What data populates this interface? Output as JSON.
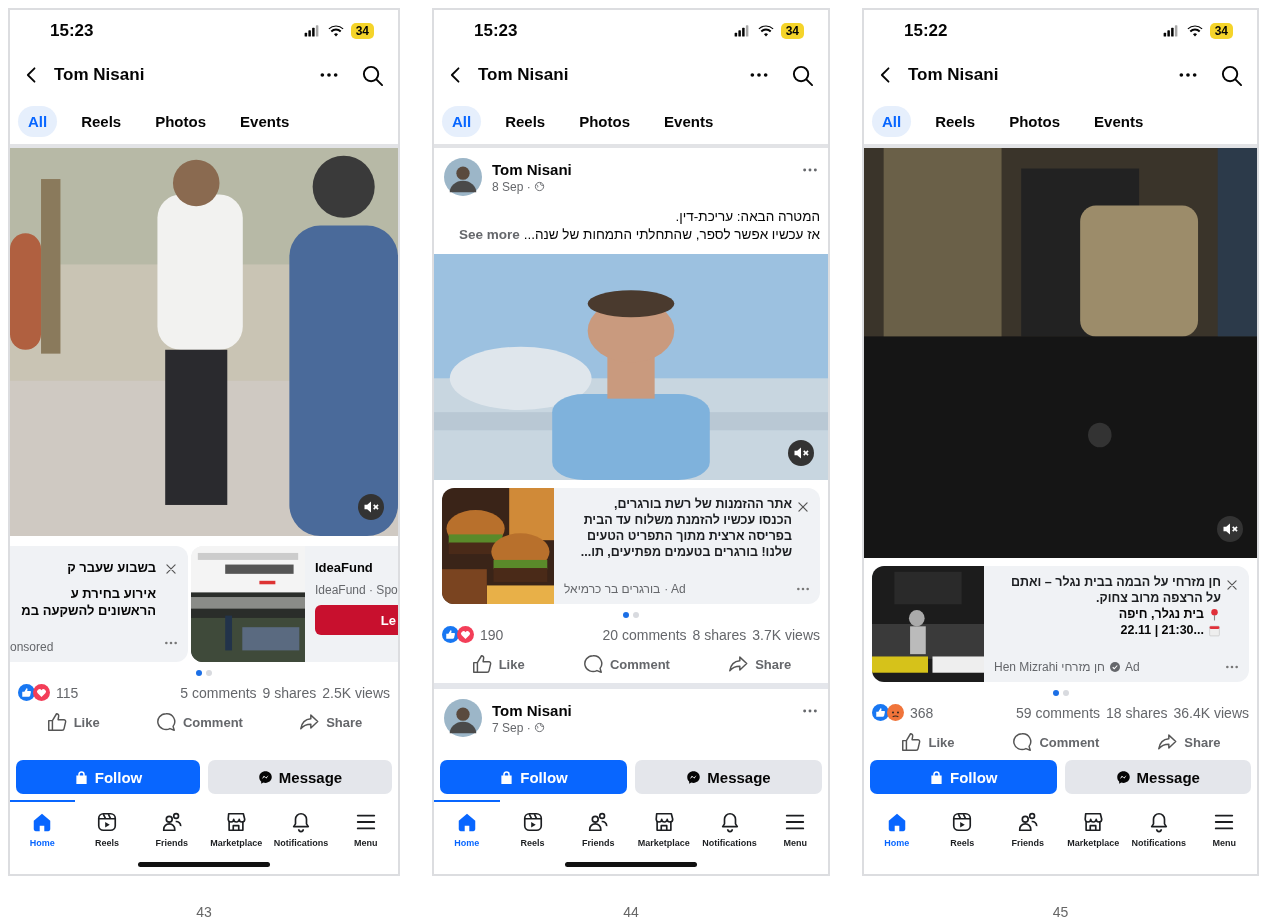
{
  "phones": [
    {
      "status": {
        "time": "15:23",
        "battery": "34"
      },
      "header": {
        "title": "Tom Nisani"
      },
      "tabs": [
        {
          "label": "All",
          "selected": true
        },
        {
          "label": "Reels",
          "selected": false
        },
        {
          "label": "Photos",
          "selected": false
        },
        {
          "label": "Events",
          "selected": false
        }
      ],
      "feed": [
        {
          "kind": "video",
          "muted": true
        },
        {
          "kind": "carousel",
          "cards": [
            {
              "kind": "text_card",
              "title": "בשבוע שעבר ק",
              "text": "אירוע בחירת ע\nהראשונים להשקעה במ",
              "label": "onsored"
            },
            {
              "kind": "link_card",
              "title": "IdeaFund",
              "subtitle": "IdeaFund · Spo",
              "button": "Le"
            }
          ]
        },
        {
          "kind": "pager",
          "pages": [
            {
              "selected": true
            },
            {
              "selected": false
            }
          ]
        },
        {
          "kind": "stats",
          "reactions": [
            {
              "kind": "like"
            },
            {
              "kind": "love"
            }
          ],
          "count": "115",
          "comments": "5 comments",
          "shares": "9 shares",
          "views": "2.5K views"
        },
        {
          "kind": "actions",
          "buttons": [
            {
              "label": "Like"
            },
            {
              "label": "Comment"
            },
            {
              "label": "Share"
            }
          ]
        }
      ],
      "profile_actions": [
        {
          "kind": "follow",
          "label": "Follow"
        },
        {
          "kind": "message",
          "label": "Message"
        }
      ],
      "nav_indicator": true,
      "nav": [
        {
          "label": "Home",
          "selected": true
        },
        {
          "label": "Reels",
          "selected": false
        },
        {
          "label": "Friends",
          "selected": false
        },
        {
          "label": "Marketplace",
          "selected": false
        },
        {
          "label": "Notifications",
          "selected": false
        },
        {
          "label": "Menu",
          "selected": false
        }
      ],
      "home_indicator": true,
      "page": "43"
    },
    {
      "status": {
        "time": "15:23",
        "battery": "34"
      },
      "header": {
        "title": "Tom Nisani"
      },
      "tabs": [
        {
          "label": "All",
          "selected": true
        },
        {
          "label": "Reels",
          "selected": false
        },
        {
          "label": "Photos",
          "selected": false
        },
        {
          "label": "Events",
          "selected": false
        }
      ],
      "feed": [
        {
          "kind": "post_header",
          "author": "Tom Nisani",
          "date": "8 Sep ·"
        },
        {
          "kind": "post_text",
          "lines": [
            "המטרה הבאה: עריכת-דין.",
            "אז עכשיו אפשר לספר, שהתחלתי התמחות של שנה..."
          ],
          "link": "See more"
        },
        {
          "kind": "video",
          "muted": true
        },
        {
          "kind": "ad",
          "text": "אתר ההזמנות של רשת בורגרים,\nהכנסו עכשיו להזמנת משלוח עד הבית\nבפריסה ארצית מתוך התפריט הטעים\nשלנו! בורגרים בטעמים מפתיעים, תו...",
          "meta": {
            "author": "בורגרים בר כרמיאל",
            "verified": false,
            "label": "· Ad"
          }
        },
        {
          "kind": "pager",
          "pages": [
            {
              "selected": true
            },
            {
              "selected": false
            }
          ]
        },
        {
          "kind": "stats",
          "reactions": [
            {
              "kind": "like"
            },
            {
              "kind": "love"
            }
          ],
          "count": "190",
          "comments": "20 comments",
          "shares": "8 shares",
          "views": "3.7K views"
        },
        {
          "kind": "actions",
          "buttons": [
            {
              "label": "Like"
            },
            {
              "label": "Comment"
            },
            {
              "label": "Share"
            }
          ]
        },
        {
          "kind": "separator"
        },
        {
          "kind": "post_header",
          "author": "Tom Nisani",
          "date": "7 Sep ·"
        }
      ],
      "profile_actions": [
        {
          "kind": "follow",
          "label": "Follow"
        },
        {
          "kind": "message",
          "label": "Message"
        }
      ],
      "nav_indicator": true,
      "nav": [
        {
          "label": "Home",
          "selected": true
        },
        {
          "label": "Reels",
          "selected": false
        },
        {
          "label": "Friends",
          "selected": false
        },
        {
          "label": "Marketplace",
          "selected": false
        },
        {
          "label": "Notifications",
          "selected": false
        },
        {
          "label": "Menu",
          "selected": false
        }
      ],
      "home_indicator": true,
      "page": "44"
    },
    {
      "status": {
        "time": "15:22",
        "battery": "34"
      },
      "header": {
        "title": "Tom Nisani"
      },
      "tabs": [
        {
          "label": "All",
          "selected": true
        },
        {
          "label": "Reels",
          "selected": false
        },
        {
          "label": "Photos",
          "selected": false
        },
        {
          "label": "Events",
          "selected": false
        }
      ],
      "feed": [
        {
          "kind": "video",
          "muted": true
        },
        {
          "kind": "ad",
          "text": "חן מזרחי על הבמה בבית נגלר – ואתם\nעל הרצפה מרוב צחוק.",
          "details": [
            {
              "kind": "pin",
              "text": "בית נגלר, חיפה"
            },
            {
              "kind": "calendar",
              "text": "22.11 | 21:30..."
            }
          ],
          "meta": {
            "author": "Hen Mizrahi חן מזרחי",
            "verified": true,
            "label": "Ad"
          }
        },
        {
          "kind": "pager",
          "pages": [
            {
              "selected": true
            },
            {
              "selected": false
            }
          ]
        },
        {
          "kind": "stats",
          "reactions": [
            {
              "kind": "like"
            },
            {
              "kind": "angry"
            }
          ],
          "count": "368",
          "comments": "59 comments",
          "shares": "18 shares",
          "views": "36.4K views"
        },
        {
          "kind": "actions",
          "buttons": [
            {
              "label": "Like"
            },
            {
              "label": "Comment"
            },
            {
              "label": "Share"
            }
          ]
        }
      ],
      "profile_actions": [
        {
          "kind": "follow",
          "label": "Follow"
        },
        {
          "kind": "message",
          "label": "Message"
        }
      ],
      "nav_indicator": false,
      "nav": [
        {
          "label": "Home",
          "selected": true
        },
        {
          "label": "Reels",
          "selected": false
        },
        {
          "label": "Friends",
          "selected": false
        },
        {
          "label": "Marketplace",
          "selected": false
        },
        {
          "label": "Notifications",
          "selected": false
        },
        {
          "label": "Menu",
          "selected": false
        }
      ],
      "home_indicator": false,
      "page": "45"
    }
  ]
}
